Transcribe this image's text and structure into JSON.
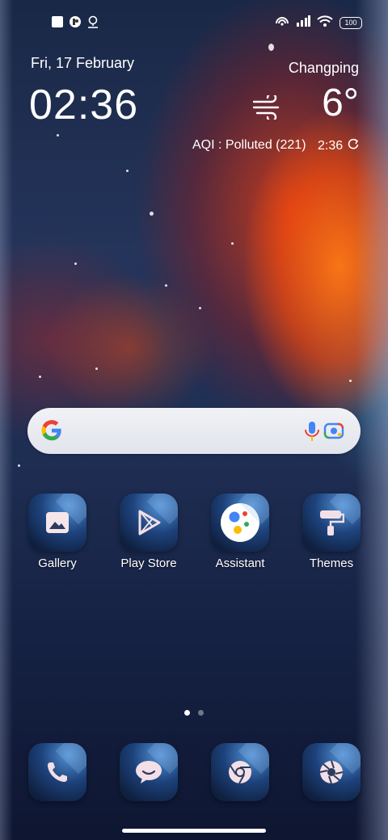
{
  "status_bar": {
    "battery": "100",
    "left_icons": [
      "square-icon",
      "app-notification-icon",
      "location-pin-icon"
    ],
    "right_icons": [
      "hotspot-icon",
      "signal-icon",
      "wifi-icon",
      "battery-icon"
    ]
  },
  "clock_widget": {
    "date": "Fri, 17 February",
    "time": "02:36"
  },
  "weather_widget": {
    "city": "Changping",
    "temperature": "6°",
    "condition_icon": "wind-icon",
    "aqi": "AQI : Polluted (221)",
    "updated_time": "2:36",
    "refresh_icon": "refresh-icon"
  },
  "search_bar": {
    "icons": [
      "google-g-icon",
      "microphone-icon",
      "lens-camera-icon"
    ]
  },
  "apps": [
    {
      "label": "Gallery",
      "icon": "gallery-icon"
    },
    {
      "label": "Play Store",
      "icon": "play-store-icon"
    },
    {
      "label": "Assistant",
      "icon": "assistant-icon"
    },
    {
      "label": "Themes",
      "icon": "paint-roller-icon"
    }
  ],
  "page_indicator": {
    "pages": 2,
    "current": 1
  },
  "dock": [
    {
      "icon": "phone-icon"
    },
    {
      "icon": "messages-icon"
    },
    {
      "icon": "chrome-icon"
    },
    {
      "icon": "camera-aperture-icon"
    }
  ],
  "colors": {
    "accent_white": "#ffffff",
    "google_blue": "#4285F4",
    "google_red": "#EA4335",
    "google_yellow": "#FBBC05",
    "google_green": "#34A853"
  }
}
